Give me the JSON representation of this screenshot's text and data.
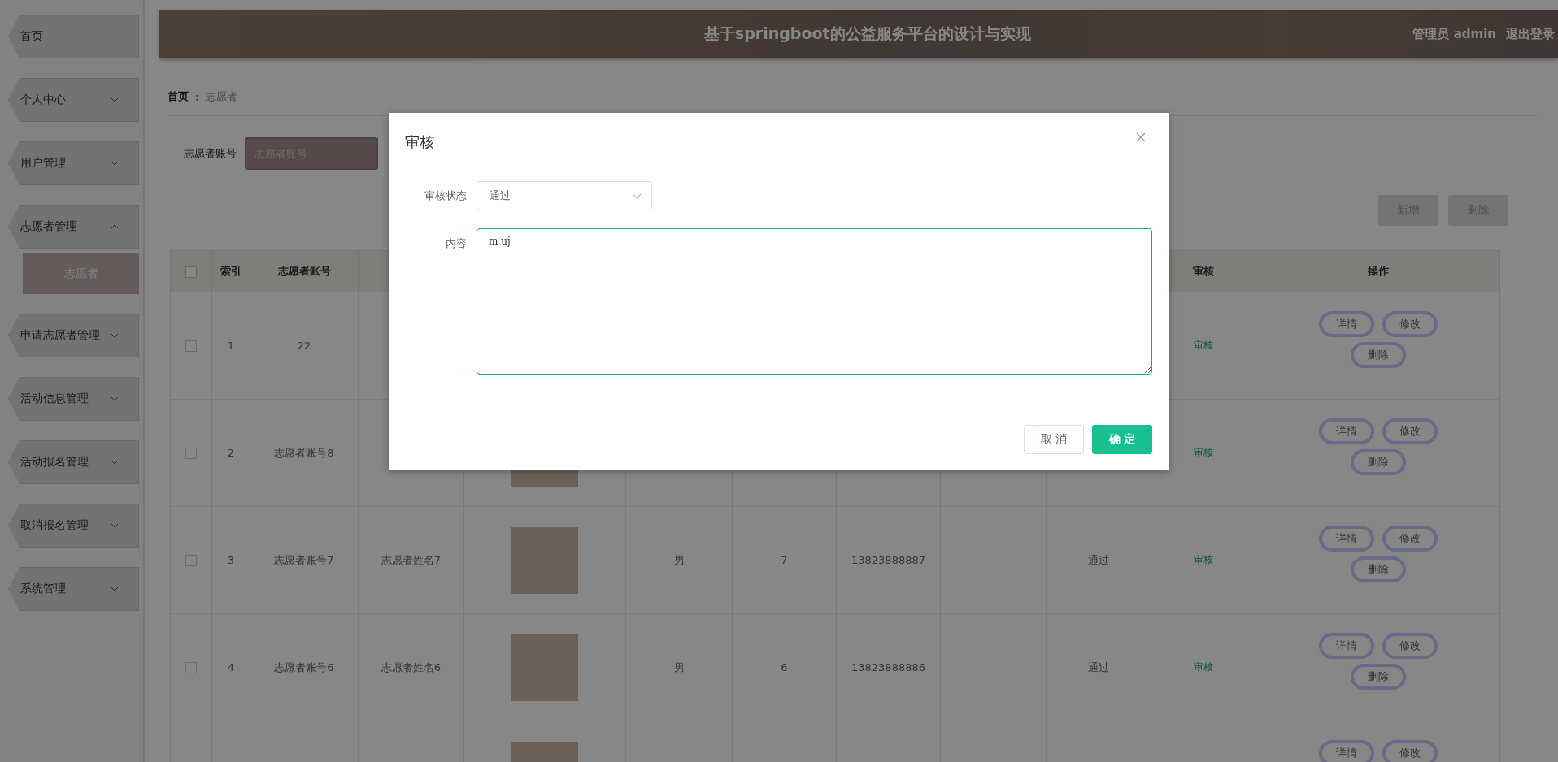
{
  "sidebar": {
    "items": [
      {
        "label": "首页"
      },
      {
        "label": "个人中心",
        "expanded": false
      },
      {
        "label": "用户管理",
        "expanded": false
      },
      {
        "label": "志愿者管理",
        "expanded": true,
        "children": [
          {
            "label": "志愿者",
            "selected": true
          }
        ]
      },
      {
        "label": "申请志愿者管理",
        "expanded": false
      },
      {
        "label": "活动信息管理",
        "expanded": false
      },
      {
        "label": "活动报名管理",
        "expanded": false
      },
      {
        "label": "取消报名管理",
        "expanded": false
      },
      {
        "label": "系统管理",
        "expanded": false
      }
    ]
  },
  "header": {
    "title": "基于springboot的公益服务平台的设计与实现",
    "user": "管理员 admin",
    "logout": "退出登录"
  },
  "breadcrumb": [
    "首页",
    "志愿者"
  ],
  "breadcrumb_separator": ":",
  "search": {
    "label": "志愿者账号",
    "placeholder": "志愿者账号"
  },
  "toolbar": [
    "新增",
    "删除"
  ],
  "table": {
    "select_all_checked": false,
    "columns": [
      {
        "label": "索引"
      },
      {
        "label": "志愿者账号"
      },
      {},
      {},
      {},
      {},
      {},
      {},
      {},
      {
        "label": "审核"
      },
      {
        "label": "操作"
      }
    ],
    "rows": [
      {
        "checked": false,
        "index": "1",
        "account": "22",
        "audit": "审核",
        "actions": [
          "详情",
          "修改",
          "删除"
        ]
      },
      {
        "checked": false,
        "index": "2",
        "account": "志愿者账号8",
        "audit": "审核",
        "actions": [
          "详情",
          "修改",
          "删除"
        ]
      },
      {
        "checked": false,
        "index": "3",
        "account": "志愿者账号7",
        "name": "志愿者姓名7",
        "gender": "男",
        "age": "7",
        "phone": "13823888887",
        "status": "通过",
        "audit": "审核",
        "actions": [
          "详情",
          "修改",
          "删除"
        ]
      },
      {
        "checked": false,
        "index": "4",
        "account": "志愿者账号6",
        "name": "志愿者姓名6",
        "gender": "男",
        "age": "6",
        "phone": "13823888886",
        "status": "通过",
        "audit": "审核",
        "actions": [
          "详情",
          "修改",
          "删除"
        ]
      },
      {
        "actions": [
          "详情",
          "修改"
        ]
      }
    ]
  },
  "dialog": {
    "title": "审核",
    "status_label": "审核状态",
    "status_value": "通过",
    "content_label": "内容",
    "content_value": "m uj",
    "buttons": [
      "取 消",
      "确 定"
    ]
  }
}
